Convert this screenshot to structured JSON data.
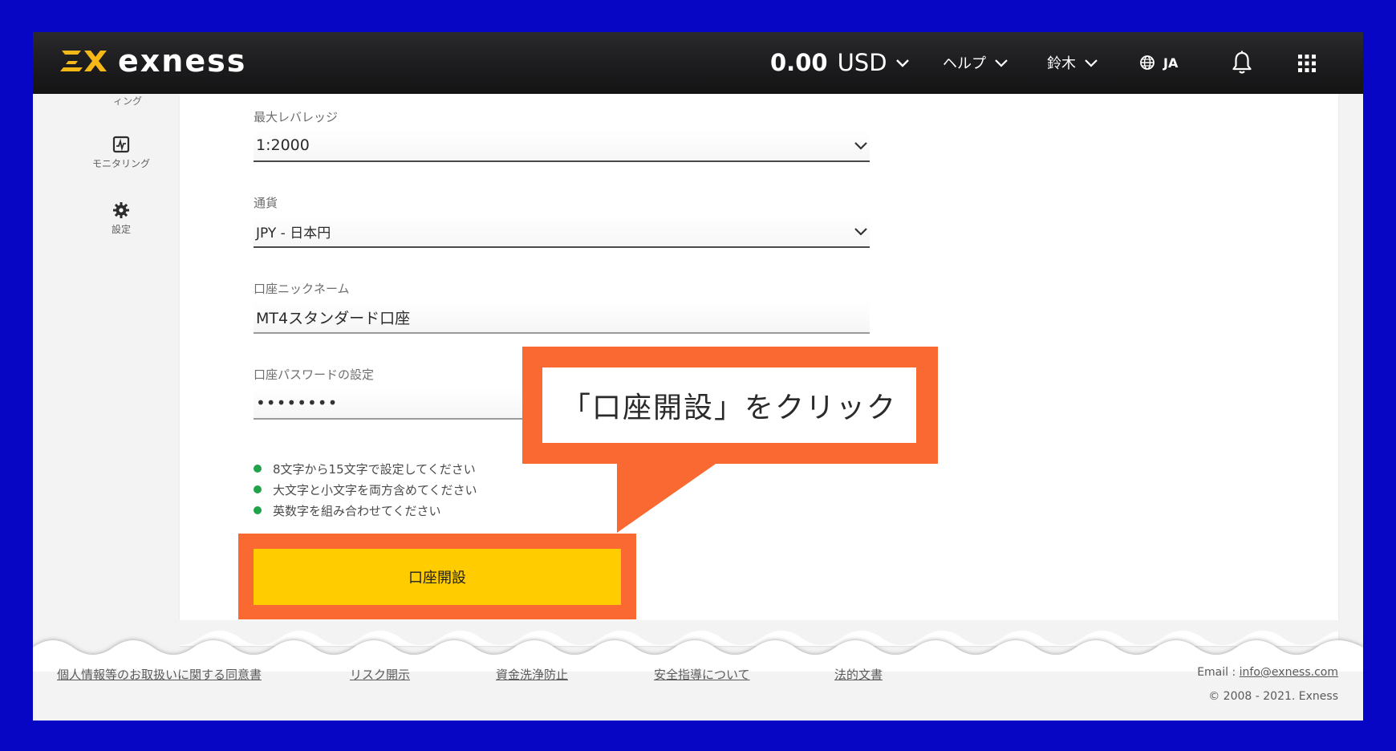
{
  "header": {
    "logo_text": "exness",
    "balance_amount": "0.00",
    "balance_currency": "USD",
    "help_label": "ヘルプ",
    "user_label": "鈴木",
    "language_label": "JA"
  },
  "sidebar": {
    "cut_label": "ィング",
    "items": [
      {
        "label": "モニタリング",
        "icon": "monitoring-chart-icon"
      },
      {
        "label": "設定",
        "icon": "gear-icon"
      }
    ]
  },
  "form": {
    "leverage": {
      "label": "最大レバレッジ",
      "value": "1:2000"
    },
    "currency": {
      "label": "通貨",
      "value": "JPY - 日本円"
    },
    "nickname": {
      "label": "口座ニックネーム",
      "value": "MT4スタンダード口座"
    },
    "password": {
      "label": "口座パスワードの設定",
      "value": "••••••••"
    },
    "rules": [
      "8文字から15文字で設定してください",
      "大文字と小文字を両方含めてください",
      "英数字を組み合わせてください"
    ],
    "submit_label": "口座開設"
  },
  "callout": {
    "text": "「口座開設」をクリック"
  },
  "footer": {
    "links": [
      "個人情報等のお取扱いに関する同意書",
      "リスク開示",
      "資金洗浄防止",
      "安全指導について",
      "法的文書"
    ],
    "email_label": "Email : ",
    "email": "info@exness.com",
    "copyright": "© 2008 - 2021. Exness"
  },
  "colors": {
    "page_border": "#0606c4",
    "accent_yellow": "#ffcc00",
    "highlight_orange": "#fa6931",
    "rule_green": "#20a34a",
    "header_bg": "#1c1c1e"
  }
}
